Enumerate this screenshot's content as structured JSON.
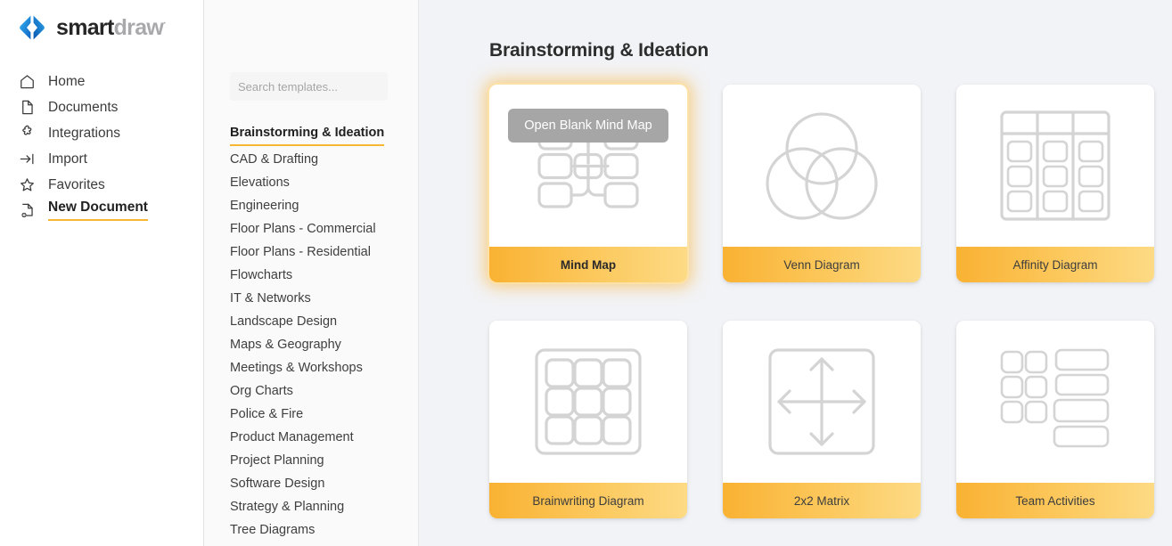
{
  "brand": {
    "name_first": "smart",
    "name_second": "draw",
    "tm": "·",
    "logo_icon": "smartdraw-diamond-logo",
    "color_first": "#262626",
    "color_second": "#a9a9ac",
    "logo_color": "#1a7ae0"
  },
  "sidebar": {
    "items": [
      {
        "label": "Home",
        "icon": "home-icon",
        "active": false
      },
      {
        "label": "Documents",
        "icon": "document-icon",
        "active": false
      },
      {
        "label": "Integrations",
        "icon": "puzzle-piece-icon",
        "active": false
      },
      {
        "label": "Import",
        "icon": "import-arrow-icon",
        "active": false
      },
      {
        "label": "Favorites",
        "icon": "star-icon",
        "active": false
      },
      {
        "label": "New Document",
        "icon": "new-document-icon",
        "active": true
      }
    ],
    "active_underline_color": "#f7b733"
  },
  "search": {
    "placeholder": "Search templates...",
    "value": "",
    "icon": "search-icon"
  },
  "categories": {
    "items": [
      {
        "label": "Brainstorming & Ideation",
        "active": true
      },
      {
        "label": "CAD & Drafting",
        "active": false
      },
      {
        "label": "Elevations",
        "active": false
      },
      {
        "label": "Engineering",
        "active": false
      },
      {
        "label": "Floor Plans - Commercial",
        "active": false
      },
      {
        "label": "Floor Plans - Residential",
        "active": false
      },
      {
        "label": "Flowcharts",
        "active": false
      },
      {
        "label": "IT & Networks",
        "active": false
      },
      {
        "label": "Landscape Design",
        "active": false
      },
      {
        "label": "Maps & Geography",
        "active": false
      },
      {
        "label": "Meetings & Workshops",
        "active": false
      },
      {
        "label": "Org Charts",
        "active": false
      },
      {
        "label": "Police & Fire",
        "active": false
      },
      {
        "label": "Product Management",
        "active": false
      },
      {
        "label": "Project Planning",
        "active": false
      },
      {
        "label": "Software Design",
        "active": false
      },
      {
        "label": "Strategy & Planning",
        "active": false
      },
      {
        "label": "Tree Diagrams",
        "active": false
      }
    ]
  },
  "main": {
    "title": "Brainstorming & Ideation",
    "footer_gradient_from": "#f9b233",
    "footer_gradient_to": "#fdda85",
    "cards": [
      {
        "label": "Mind Map",
        "thumb_icon": "mind-map-thumbnail",
        "highlighted": true,
        "overlay_label": "Open Blank Mind Map"
      },
      {
        "label": "Venn Diagram",
        "thumb_icon": "venn-diagram-thumbnail",
        "highlighted": false,
        "overlay_label": ""
      },
      {
        "label": "Affinity Diagram",
        "thumb_icon": "affinity-diagram-thumbnail",
        "highlighted": false,
        "overlay_label": ""
      },
      {
        "label": "Brainwriting Diagram",
        "thumb_icon": "brainwriting-diagram-thumbnail",
        "highlighted": false,
        "overlay_label": ""
      },
      {
        "label": "2x2 Matrix",
        "thumb_icon": "two-by-two-matrix-thumbnail",
        "highlighted": false,
        "overlay_label": ""
      },
      {
        "label": "Team Activities",
        "thumb_icon": "team-activities-thumbnail",
        "highlighted": false,
        "overlay_label": ""
      }
    ]
  }
}
